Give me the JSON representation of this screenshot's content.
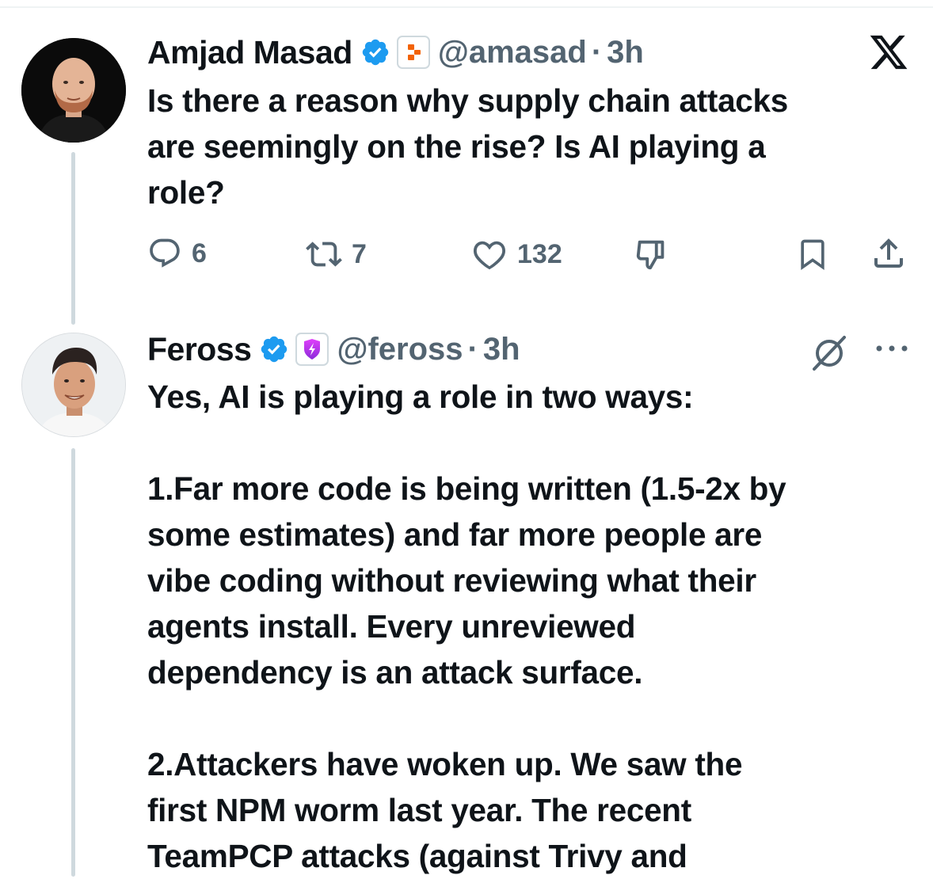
{
  "tweet1": {
    "name": "Amjad Masad",
    "handle": "@amasad",
    "separator": "·",
    "time": "3h",
    "text": "Is there a reason why supply chain attacks\nare seemingly on the rise? Is AI playing a\nrole?",
    "actions": {
      "replies": "6",
      "reposts": "7",
      "likes": "132"
    }
  },
  "tweet2": {
    "name": "Feross",
    "handle": "@feross",
    "separator": "·",
    "time": "3h",
    "text": "Yes, AI is playing a role in two ways:\n\n1.Far more code is being written (1.5-2x by\nsome estimates) and far more people are\nvibe coding without reviewing what their\nagents install. Every unreviewed\ndependency is an attack surface.\n\n2.Attackers have woken up. We saw the\nfirst NPM worm last year. The recent\nTeamPCP attacks (against Trivy and"
  },
  "colors": {
    "verified": "#1d9bf0",
    "text": "#0f1419",
    "secondary": "#536471",
    "thread_line": "#cfd9de",
    "replit_orange": "#f26207",
    "socket_purple": "#c026d3"
  },
  "icons": [
    "verified-badge-icon",
    "replit-logo-icon",
    "x-logo-icon",
    "reply-icon",
    "repost-icon",
    "like-icon",
    "dislike-icon",
    "bookmark-icon",
    "share-icon",
    "verified-badge-icon",
    "socket-logo-icon",
    "grok-icon",
    "more-icon"
  ]
}
